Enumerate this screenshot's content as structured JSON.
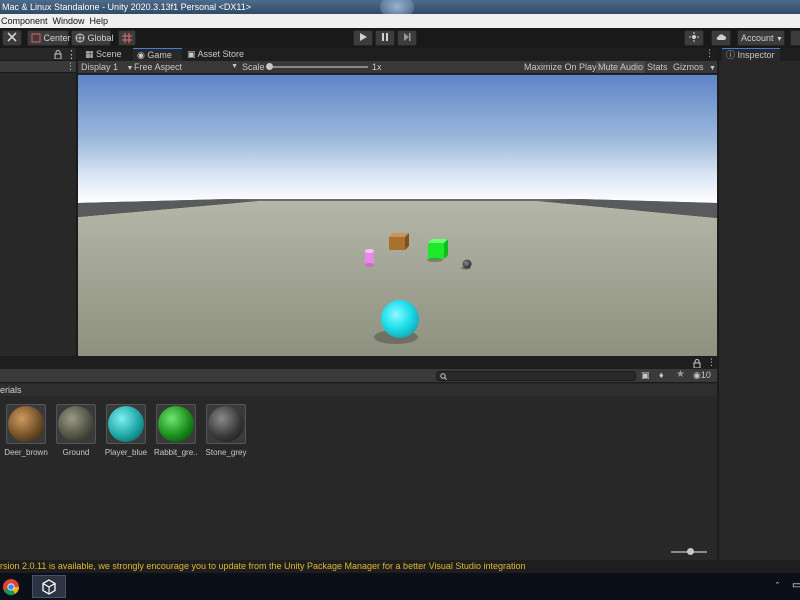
{
  "window": {
    "title": "Mac & Linux Standalone - Unity 2020.3.13f1 Personal <DX11>"
  },
  "menu": [
    "Component",
    "Window",
    "Help"
  ],
  "toolbar": {
    "pivot_label": "Center",
    "space_label": "Global",
    "account_label": "Account"
  },
  "tabs": {
    "scene": "Scene",
    "game": "Game",
    "asset_store": "Asset Store"
  },
  "game_view": {
    "display": "Display 1",
    "aspect": "Free Aspect",
    "scale_label": "Scale",
    "scale_value": "1x",
    "maximize_on_play": "Maximize On Play",
    "mute_audio": "Mute Audio",
    "stats": "Stats",
    "gizmos": "Gizmos"
  },
  "inspector": {
    "tab": "Inspector"
  },
  "project": {
    "breadcrumb": "erials",
    "hidden_count": "10",
    "materials": [
      {
        "name": "Deer_brown",
        "color": "#6b4a25"
      },
      {
        "name": "Ground",
        "color": "#4c4c40"
      },
      {
        "name": "Player_blue",
        "color": "#1ea5a5"
      },
      {
        "name": "Rabbit_gre...",
        "color": "#1b8c1b"
      },
      {
        "name": "Stone_grey",
        "color": "#3a3a3a"
      }
    ]
  },
  "status": {
    "message": "rsion 2.0.11 is available, we strongly encourage you to update from the Unity Package Manager for a better Visual Studio integration"
  },
  "colors": {
    "accent": "#3d7ede",
    "status_text": "#e0b833",
    "sky_top": "#5f84c6",
    "ground": "#9da08f",
    "player": "#20e6f0",
    "cube": "#1ee82a",
    "crate": "#b07a35",
    "cylinder": "#e58ae5"
  }
}
